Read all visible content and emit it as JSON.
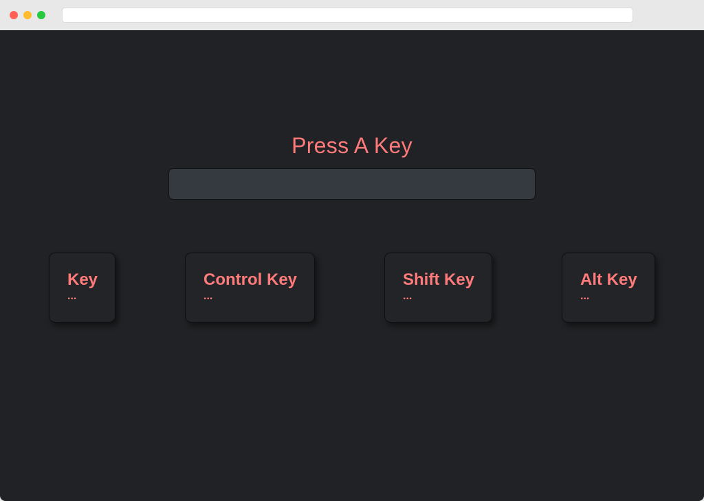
{
  "browser": {
    "address": ""
  },
  "page": {
    "title": "Press A Key",
    "input_value": ""
  },
  "cards": [
    {
      "label": "Key",
      "value": "..."
    },
    {
      "label": "Control Key",
      "value": "..."
    },
    {
      "label": "Shift Key",
      "value": "..."
    },
    {
      "label": "Alt Key",
      "value": "..."
    }
  ],
  "colors": {
    "accent": "#ff7a7a",
    "background": "#202225",
    "input_bg": "#343a40",
    "card_bg": "#222427"
  }
}
